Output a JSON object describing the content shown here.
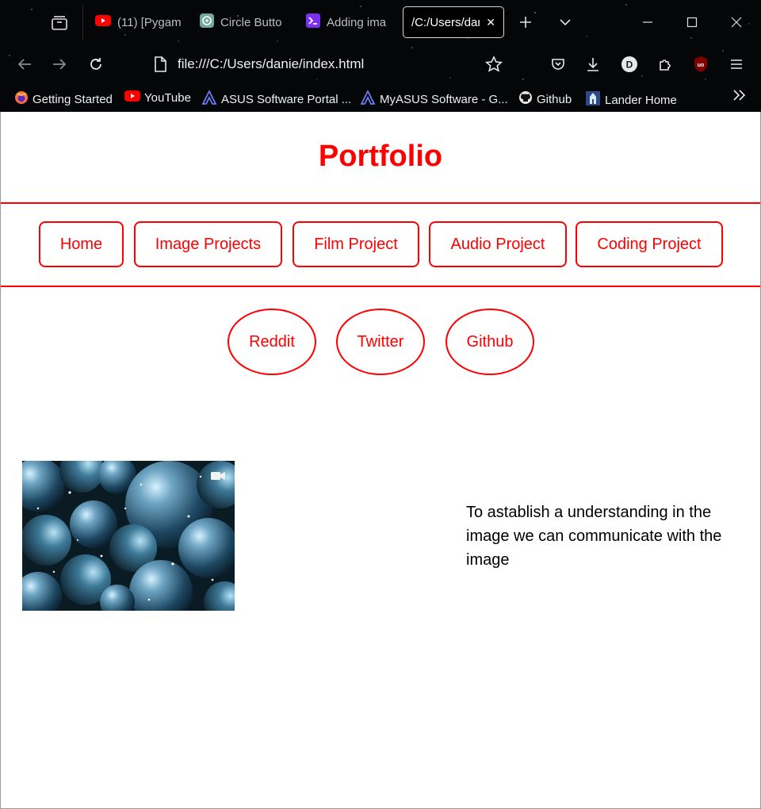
{
  "browser": {
    "tabs": [
      {
        "title": "(11) [Pygam",
        "icon": "youtube-icon",
        "active": false
      },
      {
        "title": "Circle Butto",
        "icon": "chatgpt-icon",
        "active": false
      },
      {
        "title": "Adding ima",
        "icon": "terminal-icon",
        "active": false
      },
      {
        "title": "/C:/Users/dan",
        "icon": "",
        "active": true
      }
    ],
    "url": "file:///C:/Users/danie/index.html",
    "profile_initial": "D",
    "bookmarks": [
      {
        "label": "Getting Started",
        "icon": "firefox-icon"
      },
      {
        "label": "YouTube",
        "icon": "youtube-icon"
      },
      {
        "label": "ASUS Software Portal ...",
        "icon": "asus-icon"
      },
      {
        "label": "MyASUS Software - G...",
        "icon": "asus-icon"
      },
      {
        "label": "Github",
        "icon": "github-icon"
      },
      {
        "label": "Lander Home",
        "icon": "lander-icon"
      }
    ]
  },
  "page": {
    "title": "Portfolio",
    "nav": [
      "Home",
      "Image Projects",
      "Film Project",
      "Audio Project",
      "Coding Project"
    ],
    "social": [
      "Reddit",
      "Twitter",
      "Github"
    ],
    "description": "To astablish a understanding in the image we can communicate with the image",
    "accent_color": "#ff0000"
  }
}
